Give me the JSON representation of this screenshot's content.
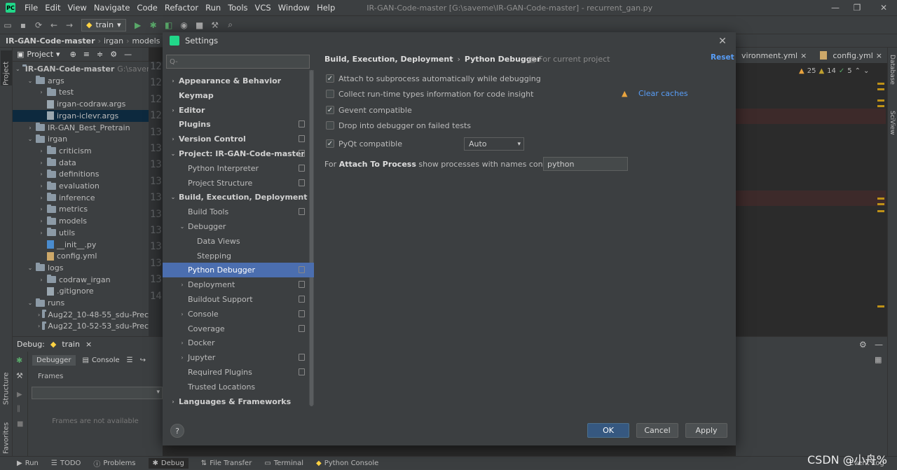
{
  "menubar": {
    "items": [
      "File",
      "Edit",
      "View",
      "Navigate",
      "Code",
      "Refactor",
      "Run",
      "Tools",
      "VCS",
      "Window",
      "Help"
    ],
    "window_title": "IR-GAN-Code-master [G:\\saveme\\IR-GAN-Code-master] - recurrent_gan.py"
  },
  "toolbar": {
    "run_config": "train"
  },
  "breadcrumb": {
    "root": "IR-GAN-Code-master",
    "items": [
      "irgan",
      "models"
    ]
  },
  "left_tool": {
    "project": "Project",
    "structure": "Structure",
    "favorites": "Favorites"
  },
  "right_tool": {
    "database": "Database",
    "sciview": "SciView"
  },
  "project_panel": {
    "header": "Project",
    "tree": [
      {
        "label": "IR-GAN-Code-master",
        "hint": "G:\\saveme",
        "type": "folder",
        "depth": 0,
        "open": true,
        "bold": true
      },
      {
        "label": "args",
        "type": "folder",
        "depth": 1,
        "open": true
      },
      {
        "label": "test",
        "type": "folder",
        "depth": 2,
        "open": false
      },
      {
        "label": "irgan-codraw.args",
        "type": "file",
        "depth": 2
      },
      {
        "label": "irgan-iclevr.args",
        "type": "file",
        "depth": 2,
        "selected": true
      },
      {
        "label": "IR-GAN_Best_Pretrain",
        "type": "folder",
        "depth": 1,
        "open": false
      },
      {
        "label": "irgan",
        "type": "folder",
        "depth": 1,
        "open": true
      },
      {
        "label": "criticism",
        "type": "folder",
        "depth": 2,
        "open": false
      },
      {
        "label": "data",
        "type": "folder",
        "depth": 2,
        "open": false
      },
      {
        "label": "definitions",
        "type": "folder",
        "depth": 2,
        "open": false
      },
      {
        "label": "evaluation",
        "type": "folder",
        "depth": 2,
        "open": false
      },
      {
        "label": "inference",
        "type": "folder",
        "depth": 2,
        "open": false
      },
      {
        "label": "metrics",
        "type": "folder",
        "depth": 2,
        "open": false
      },
      {
        "label": "models",
        "type": "folder",
        "depth": 2,
        "open": false
      },
      {
        "label": "utils",
        "type": "folder",
        "depth": 2,
        "open": false
      },
      {
        "label": "__init__.py",
        "type": "py",
        "depth": 2
      },
      {
        "label": "config.yml",
        "type": "yml",
        "depth": 2
      },
      {
        "label": "logs",
        "type": "folder",
        "depth": 1,
        "open": true
      },
      {
        "label": "codraw_irgan",
        "type": "folder",
        "depth": 2,
        "open": false
      },
      {
        "label": ".gitignore",
        "type": "file",
        "depth": 2
      },
      {
        "label": "runs",
        "type": "folder",
        "depth": 1,
        "open": true
      },
      {
        "label": "Aug22_10-48-55_sdu-Prec",
        "type": "folder",
        "depth": 2,
        "open": false
      },
      {
        "label": "Aug22_10-52-53_sdu-Prec",
        "type": "folder",
        "depth": 2,
        "open": false
      }
    ]
  },
  "gutter_numbers": [
    "12",
    "12",
    "12",
    "12",
    "13",
    "13",
    "13",
    "13",
    "13",
    "13",
    "13",
    "13",
    "13",
    "13",
    "14"
  ],
  "editor": {
    "tabs": [
      "vironment.yml",
      "config.yml"
    ],
    "inspections": {
      "warnings": "25",
      "weak": "14",
      "ok": "5"
    }
  },
  "debug": {
    "label": "Debug:",
    "config": "train",
    "tabs": [
      "Debugger",
      "Console"
    ],
    "frames_header": "Frames",
    "frames_empty": "Frames are not available"
  },
  "statusbar": {
    "items": [
      "Run",
      "TODO",
      "Problems",
      "Debug",
      "File Transfer",
      "Terminal",
      "Python Console"
    ],
    "event_log": "Event Log"
  },
  "watermark": "CSDN @小舟%",
  "settings": {
    "title": "Settings",
    "search_placeholder": "Q-",
    "nav": [
      {
        "label": "Appearance & Behavior",
        "bold": true,
        "tri": "›",
        "depth": 0
      },
      {
        "label": "Keymap",
        "bold": true,
        "tri": "",
        "depth": 0
      },
      {
        "label": "Editor",
        "bold": true,
        "tri": "›",
        "depth": 0
      },
      {
        "label": "Plugins",
        "bold": true,
        "tri": "",
        "depth": 0,
        "pj": true
      },
      {
        "label": "Version Control",
        "bold": true,
        "tri": "›",
        "depth": 0,
        "pj": true
      },
      {
        "label": "Project: IR-GAN-Code-master",
        "bold": true,
        "tri": "⌄",
        "depth": 0,
        "pj": true
      },
      {
        "label": "Python Interpreter",
        "depth": 1,
        "tri": "",
        "pj": true
      },
      {
        "label": "Project Structure",
        "depth": 1,
        "tri": "",
        "pj": true
      },
      {
        "label": "Build, Execution, Deployment",
        "bold": true,
        "tri": "⌄",
        "depth": 0
      },
      {
        "label": "Build Tools",
        "depth": 1,
        "tri": "",
        "pj": true
      },
      {
        "label": "Debugger",
        "depth": 1,
        "tri": "⌄"
      },
      {
        "label": "Data Views",
        "depth": 2,
        "tri": ""
      },
      {
        "label": "Stepping",
        "depth": 2,
        "tri": ""
      },
      {
        "label": "Python Debugger",
        "depth": 1,
        "tri": "",
        "pj": true,
        "selected": true
      },
      {
        "label": "Deployment",
        "depth": 1,
        "tri": "›",
        "pj": true
      },
      {
        "label": "Buildout Support",
        "depth": 1,
        "tri": "",
        "pj": true
      },
      {
        "label": "Console",
        "depth": 1,
        "tri": "›",
        "pj": true
      },
      {
        "label": "Coverage",
        "depth": 1,
        "tri": "",
        "pj": true
      },
      {
        "label": "Docker",
        "depth": 1,
        "tri": "›"
      },
      {
        "label": "Jupyter",
        "depth": 1,
        "tri": "›",
        "pj": true
      },
      {
        "label": "Required Plugins",
        "depth": 1,
        "tri": "",
        "pj": true
      },
      {
        "label": "Trusted Locations",
        "depth": 1,
        "tri": ""
      },
      {
        "label": "Languages & Frameworks",
        "bold": true,
        "tri": "›",
        "depth": 0
      }
    ],
    "breadcrumb": [
      "Build, Execution, Deployment",
      "Python Debugger"
    ],
    "for_current_project": "For current project",
    "reset": "Reset",
    "options": [
      {
        "label": "Attach to subprocess automatically while debugging",
        "checked": true
      },
      {
        "label": "Collect run-time types information for code insight",
        "checked": false
      },
      {
        "label": "Gevent compatible",
        "checked": true
      },
      {
        "label": "Drop into debugger on failed tests",
        "checked": false
      },
      {
        "label": "PyQt compatible",
        "checked": true
      }
    ],
    "clear_caches": "Clear caches",
    "pyqt_mode": "Auto",
    "attach_prefix": "For",
    "attach_bold": "Attach To Process",
    "attach_suffix": "show processes with names containing:",
    "attach_value": "python",
    "buttons": {
      "ok": "OK",
      "cancel": "Cancel",
      "apply": "Apply"
    },
    "help": "?"
  }
}
